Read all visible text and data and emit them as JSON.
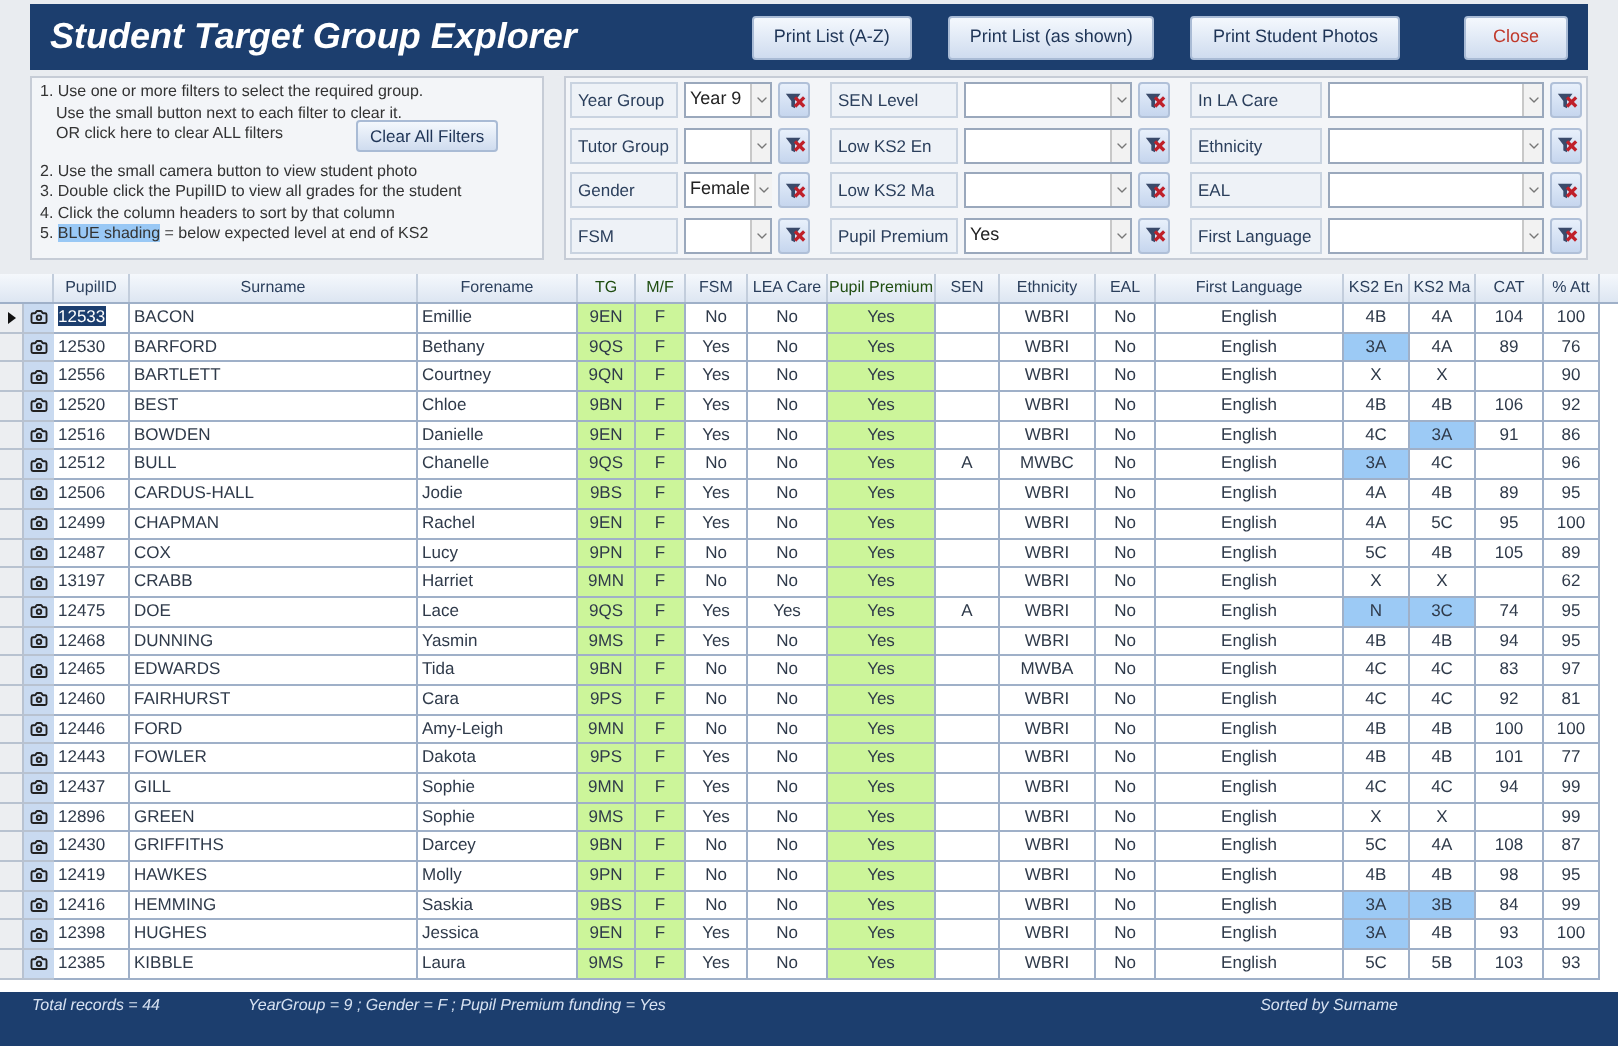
{
  "title": "Student Target Group Explorer",
  "buttons": [
    {
      "label": "Print List (A-Z)",
      "kind": "print"
    },
    {
      "label": "Print List (as shown)",
      "kind": "print"
    },
    {
      "label": "Print Student Photos",
      "kind": "print"
    },
    {
      "label": "Close",
      "kind": "close"
    }
  ],
  "instructions": [
    {
      "text": "1. Use one or more filters to select the required group."
    },
    {
      "text": "Use the small button next to each filter to clear it.",
      "indent": true
    },
    {
      "text": "OR click here to clear ALL filters",
      "indent": true
    },
    {
      "text": "2. Use the small camera button to view student photo"
    },
    {
      "text": "3. Double click the PupilID to view all grades for the student"
    },
    {
      "text": "4. Click the column headers to sort by that column"
    },
    {
      "text": "5. ",
      "highlight": "BLUE shading",
      "rest": " = below expected level at end of KS2"
    }
  ],
  "clear_all_button": "Clear All Filters",
  "filter_columns": [
    [
      {
        "label": "Year Group",
        "value": "Year 9"
      },
      {
        "label": "Tutor Group"
      },
      {
        "label": "Gender",
        "value": "Female"
      },
      {
        "label": "FSM"
      }
    ],
    [
      {
        "label": "SEN Level"
      },
      {
        "label": "Low KS2 En"
      },
      {
        "label": "Low KS2 Ma"
      },
      {
        "label": "Pupil Premium",
        "value": "Yes"
      }
    ],
    [
      {
        "label": "In LA Care"
      },
      {
        "label": "Ethnicity"
      },
      {
        "label": "EAL"
      },
      {
        "label": "First Language"
      }
    ]
  ],
  "table": {
    "columns": [
      {
        "label": "PupilID",
        "highlighted": false
      },
      {
        "label": "Surname",
        "highlighted": false
      },
      {
        "label": "Forename",
        "highlighted": false
      },
      {
        "label": "TG",
        "highlighted": true
      },
      {
        "label": "M/F",
        "highlighted": true
      },
      {
        "label": "FSM",
        "highlighted": false
      },
      {
        "label": "LEA Care",
        "highlighted": false
      },
      {
        "label": "Pupil Premium",
        "highlighted": true
      },
      {
        "label": "SEN",
        "highlighted": false
      },
      {
        "label": "Ethnicity",
        "highlighted": false
      },
      {
        "label": "EAL",
        "highlighted": false
      },
      {
        "label": "First Language",
        "highlighted": false
      },
      {
        "label": "KS2 En",
        "highlighted": false
      },
      {
        "label": "KS2 Ma",
        "highlighted": false
      },
      {
        "label": "CAT",
        "highlighted": false
      },
      {
        "label": "% Att",
        "highlighted": false
      }
    ],
    "rows": [
      {
        "selected": true,
        "cells": [
          {
            "text": "12533"
          },
          {
            "text": "BACON"
          },
          {
            "text": "Emillie"
          },
          {
            "text": "9EN"
          },
          {
            "text": "F"
          },
          {
            "text": "No"
          },
          {
            "text": "No"
          },
          {
            "text": "Yes"
          },
          {},
          {
            "text": "WBRI"
          },
          {
            "text": "No"
          },
          {
            "text": "English"
          },
          {
            "text": "4B",
            "low": false
          },
          {
            "text": "4A",
            "low": false
          },
          {
            "text": "104"
          },
          {
            "text": "100"
          }
        ]
      },
      {
        "selected": false,
        "cells": [
          {
            "text": "12530"
          },
          {
            "text": "BARFORD"
          },
          {
            "text": "Bethany"
          },
          {
            "text": "9QS"
          },
          {
            "text": "F"
          },
          {
            "text": "Yes"
          },
          {
            "text": "No"
          },
          {
            "text": "Yes"
          },
          {},
          {
            "text": "WBRI"
          },
          {
            "text": "No"
          },
          {
            "text": "English"
          },
          {
            "text": "3A",
            "low": true
          },
          {
            "text": "4A",
            "low": false
          },
          {
            "text": "89"
          },
          {
            "text": "76"
          }
        ]
      },
      {
        "selected": false,
        "cells": [
          {
            "text": "12556"
          },
          {
            "text": "BARTLETT"
          },
          {
            "text": "Courtney"
          },
          {
            "text": "9QN"
          },
          {
            "text": "F"
          },
          {
            "text": "Yes"
          },
          {
            "text": "No"
          },
          {
            "text": "Yes"
          },
          {},
          {
            "text": "WBRI"
          },
          {
            "text": "No"
          },
          {
            "text": "English"
          },
          {
            "text": "X",
            "low": false
          },
          {
            "text": "X",
            "low": false
          },
          {},
          {
            "text": "90"
          }
        ]
      },
      {
        "selected": false,
        "cells": [
          {
            "text": "12520"
          },
          {
            "text": "BEST"
          },
          {
            "text": "Chloe"
          },
          {
            "text": "9BN"
          },
          {
            "text": "F"
          },
          {
            "text": "Yes"
          },
          {
            "text": "No"
          },
          {
            "text": "Yes"
          },
          {},
          {
            "text": "WBRI"
          },
          {
            "text": "No"
          },
          {
            "text": "English"
          },
          {
            "text": "4B",
            "low": false
          },
          {
            "text": "4B",
            "low": false
          },
          {
            "text": "106"
          },
          {
            "text": "92"
          }
        ]
      },
      {
        "selected": false,
        "cells": [
          {
            "text": "12516"
          },
          {
            "text": "BOWDEN"
          },
          {
            "text": "Danielle"
          },
          {
            "text": "9EN"
          },
          {
            "text": "F"
          },
          {
            "text": "Yes"
          },
          {
            "text": "No"
          },
          {
            "text": "Yes"
          },
          {},
          {
            "text": "WBRI"
          },
          {
            "text": "No"
          },
          {
            "text": "English"
          },
          {
            "text": "4C",
            "low": false
          },
          {
            "text": "3A",
            "low": true
          },
          {
            "text": "91"
          },
          {
            "text": "86"
          }
        ]
      },
      {
        "selected": false,
        "cells": [
          {
            "text": "12512"
          },
          {
            "text": "BULL"
          },
          {
            "text": "Chanelle"
          },
          {
            "text": "9QS"
          },
          {
            "text": "F"
          },
          {
            "text": "No"
          },
          {
            "text": "No"
          },
          {
            "text": "Yes"
          },
          {
            "text": "A"
          },
          {
            "text": "MWBC"
          },
          {
            "text": "No"
          },
          {
            "text": "English"
          },
          {
            "text": "3A",
            "low": true
          },
          {
            "text": "4C",
            "low": false
          },
          {},
          {
            "text": "96"
          }
        ]
      },
      {
        "selected": false,
        "cells": [
          {
            "text": "12506"
          },
          {
            "text": "CARDUS-HALL"
          },
          {
            "text": "Jodie"
          },
          {
            "text": "9BS"
          },
          {
            "text": "F"
          },
          {
            "text": "Yes"
          },
          {
            "text": "No"
          },
          {
            "text": "Yes"
          },
          {},
          {
            "text": "WBRI"
          },
          {
            "text": "No"
          },
          {
            "text": "English"
          },
          {
            "text": "4A",
            "low": false
          },
          {
            "text": "4B",
            "low": false
          },
          {
            "text": "89"
          },
          {
            "text": "95"
          }
        ]
      },
      {
        "selected": false,
        "cells": [
          {
            "text": "12499"
          },
          {
            "text": "CHAPMAN"
          },
          {
            "text": "Rachel"
          },
          {
            "text": "9EN"
          },
          {
            "text": "F"
          },
          {
            "text": "Yes"
          },
          {
            "text": "No"
          },
          {
            "text": "Yes"
          },
          {},
          {
            "text": "WBRI"
          },
          {
            "text": "No"
          },
          {
            "text": "English"
          },
          {
            "text": "4A",
            "low": false
          },
          {
            "text": "5C",
            "low": false
          },
          {
            "text": "95"
          },
          {
            "text": "100"
          }
        ]
      },
      {
        "selected": false,
        "cells": [
          {
            "text": "12487"
          },
          {
            "text": "COX"
          },
          {
            "text": "Lucy"
          },
          {
            "text": "9PN"
          },
          {
            "text": "F"
          },
          {
            "text": "No"
          },
          {
            "text": "No"
          },
          {
            "text": "Yes"
          },
          {},
          {
            "text": "WBRI"
          },
          {
            "text": "No"
          },
          {
            "text": "English"
          },
          {
            "text": "5C",
            "low": false
          },
          {
            "text": "4B",
            "low": false
          },
          {
            "text": "105"
          },
          {
            "text": "89"
          }
        ]
      },
      {
        "selected": false,
        "cells": [
          {
            "text": "13197"
          },
          {
            "text": "CRABB"
          },
          {
            "text": "Harriet"
          },
          {
            "text": "9MN"
          },
          {
            "text": "F"
          },
          {
            "text": "No"
          },
          {
            "text": "No"
          },
          {
            "text": "Yes"
          },
          {},
          {
            "text": "WBRI"
          },
          {
            "text": "No"
          },
          {
            "text": "English"
          },
          {
            "text": "X",
            "low": false
          },
          {
            "text": "X",
            "low": false
          },
          {},
          {
            "text": "62"
          }
        ]
      },
      {
        "selected": false,
        "cells": [
          {
            "text": "12475"
          },
          {
            "text": "DOE"
          },
          {
            "text": "Lace"
          },
          {
            "text": "9QS"
          },
          {
            "text": "F"
          },
          {
            "text": "Yes"
          },
          {
            "text": "Yes"
          },
          {
            "text": "Yes"
          },
          {
            "text": "A"
          },
          {
            "text": "WBRI"
          },
          {
            "text": "No"
          },
          {
            "text": "English"
          },
          {
            "text": "N",
            "low": true
          },
          {
            "text": "3C",
            "low": true
          },
          {
            "text": "74"
          },
          {
            "text": "95"
          }
        ]
      },
      {
        "selected": false,
        "cells": [
          {
            "text": "12468"
          },
          {
            "text": "DUNNING"
          },
          {
            "text": "Yasmin"
          },
          {
            "text": "9MS"
          },
          {
            "text": "F"
          },
          {
            "text": "Yes"
          },
          {
            "text": "No"
          },
          {
            "text": "Yes"
          },
          {},
          {
            "text": "WBRI"
          },
          {
            "text": "No"
          },
          {
            "text": "English"
          },
          {
            "text": "4B",
            "low": false
          },
          {
            "text": "4B",
            "low": false
          },
          {
            "text": "94"
          },
          {
            "text": "95"
          }
        ]
      },
      {
        "selected": false,
        "cells": [
          {
            "text": "12465"
          },
          {
            "text": "EDWARDS"
          },
          {
            "text": "Tida"
          },
          {
            "text": "9BN"
          },
          {
            "text": "F"
          },
          {
            "text": "No"
          },
          {
            "text": "No"
          },
          {
            "text": "Yes"
          },
          {},
          {
            "text": "MWBA"
          },
          {
            "text": "No"
          },
          {
            "text": "English"
          },
          {
            "text": "4C",
            "low": false
          },
          {
            "text": "4C",
            "low": false
          },
          {
            "text": "83"
          },
          {
            "text": "97"
          }
        ]
      },
      {
        "selected": false,
        "cells": [
          {
            "text": "12460"
          },
          {
            "text": "FAIRHURST"
          },
          {
            "text": "Cara"
          },
          {
            "text": "9PS"
          },
          {
            "text": "F"
          },
          {
            "text": "No"
          },
          {
            "text": "No"
          },
          {
            "text": "Yes"
          },
          {},
          {
            "text": "WBRI"
          },
          {
            "text": "No"
          },
          {
            "text": "English"
          },
          {
            "text": "4C",
            "low": false
          },
          {
            "text": "4C",
            "low": false
          },
          {
            "text": "92"
          },
          {
            "text": "81"
          }
        ]
      },
      {
        "selected": false,
        "cells": [
          {
            "text": "12446"
          },
          {
            "text": "FORD"
          },
          {
            "text": "Amy-Leigh"
          },
          {
            "text": "9MN"
          },
          {
            "text": "F"
          },
          {
            "text": "No"
          },
          {
            "text": "No"
          },
          {
            "text": "Yes"
          },
          {},
          {
            "text": "WBRI"
          },
          {
            "text": "No"
          },
          {
            "text": "English"
          },
          {
            "text": "4B",
            "low": false
          },
          {
            "text": "4B",
            "low": false
          },
          {
            "text": "100"
          },
          {
            "text": "100"
          }
        ]
      },
      {
        "selected": false,
        "cells": [
          {
            "text": "12443"
          },
          {
            "text": "FOWLER"
          },
          {
            "text": "Dakota"
          },
          {
            "text": "9PS"
          },
          {
            "text": "F"
          },
          {
            "text": "Yes"
          },
          {
            "text": "No"
          },
          {
            "text": "Yes"
          },
          {},
          {
            "text": "WBRI"
          },
          {
            "text": "No"
          },
          {
            "text": "English"
          },
          {
            "text": "4B",
            "low": false
          },
          {
            "text": "4B",
            "low": false
          },
          {
            "text": "101"
          },
          {
            "text": "77"
          }
        ]
      },
      {
        "selected": false,
        "cells": [
          {
            "text": "12437"
          },
          {
            "text": "GILL"
          },
          {
            "text": "Sophie"
          },
          {
            "text": "9MN"
          },
          {
            "text": "F"
          },
          {
            "text": "Yes"
          },
          {
            "text": "No"
          },
          {
            "text": "Yes"
          },
          {},
          {
            "text": "WBRI"
          },
          {
            "text": "No"
          },
          {
            "text": "English"
          },
          {
            "text": "4C",
            "low": false
          },
          {
            "text": "4C",
            "low": false
          },
          {
            "text": "94"
          },
          {
            "text": "99"
          }
        ]
      },
      {
        "selected": false,
        "cells": [
          {
            "text": "12896"
          },
          {
            "text": "GREEN"
          },
          {
            "text": "Sophie"
          },
          {
            "text": "9MS"
          },
          {
            "text": "F"
          },
          {
            "text": "Yes"
          },
          {
            "text": "No"
          },
          {
            "text": "Yes"
          },
          {},
          {
            "text": "WBRI"
          },
          {
            "text": "No"
          },
          {
            "text": "English"
          },
          {
            "text": "X",
            "low": false
          },
          {
            "text": "X",
            "low": false
          },
          {},
          {
            "text": "99"
          }
        ]
      },
      {
        "selected": false,
        "cells": [
          {
            "text": "12430"
          },
          {
            "text": "GRIFFITHS"
          },
          {
            "text": "Darcey"
          },
          {
            "text": "9BN"
          },
          {
            "text": "F"
          },
          {
            "text": "No"
          },
          {
            "text": "No"
          },
          {
            "text": "Yes"
          },
          {},
          {
            "text": "WBRI"
          },
          {
            "text": "No"
          },
          {
            "text": "English"
          },
          {
            "text": "5C",
            "low": false
          },
          {
            "text": "4A",
            "low": false
          },
          {
            "text": "108"
          },
          {
            "text": "87"
          }
        ]
      },
      {
        "selected": false,
        "cells": [
          {
            "text": "12419"
          },
          {
            "text": "HAWKES"
          },
          {
            "text": "Molly"
          },
          {
            "text": "9PN"
          },
          {
            "text": "F"
          },
          {
            "text": "No"
          },
          {
            "text": "No"
          },
          {
            "text": "Yes"
          },
          {},
          {
            "text": "WBRI"
          },
          {
            "text": "No"
          },
          {
            "text": "English"
          },
          {
            "text": "4B",
            "low": false
          },
          {
            "text": "4B",
            "low": false
          },
          {
            "text": "98"
          },
          {
            "text": "95"
          }
        ]
      },
      {
        "selected": false,
        "cells": [
          {
            "text": "12416"
          },
          {
            "text": "HEMMING"
          },
          {
            "text": "Saskia"
          },
          {
            "text": "9BS"
          },
          {
            "text": "F"
          },
          {
            "text": "No"
          },
          {
            "text": "No"
          },
          {
            "text": "Yes"
          },
          {},
          {
            "text": "WBRI"
          },
          {
            "text": "No"
          },
          {
            "text": "English"
          },
          {
            "text": "3A",
            "low": true
          },
          {
            "text": "3B",
            "low": true
          },
          {
            "text": "84"
          },
          {
            "text": "99"
          }
        ]
      },
      {
        "selected": false,
        "cells": [
          {
            "text": "12398"
          },
          {
            "text": "HUGHES"
          },
          {
            "text": "Jessica"
          },
          {
            "text": "9EN"
          },
          {
            "text": "F"
          },
          {
            "text": "Yes"
          },
          {
            "text": "No"
          },
          {
            "text": "Yes"
          },
          {},
          {
            "text": "WBRI"
          },
          {
            "text": "No"
          },
          {
            "text": "English"
          },
          {
            "text": "3A",
            "low": true
          },
          {
            "text": "4B",
            "low": false
          },
          {
            "text": "93"
          },
          {
            "text": "100"
          }
        ]
      },
      {
        "selected": false,
        "cells": [
          {
            "text": "12385"
          },
          {
            "text": "KIBBLE"
          },
          {
            "text": "Laura"
          },
          {
            "text": "9MS"
          },
          {
            "text": "F"
          },
          {
            "text": "Yes"
          },
          {
            "text": "No"
          },
          {
            "text": "Yes"
          },
          {},
          {
            "text": "WBRI"
          },
          {
            "text": "No"
          },
          {
            "text": "English"
          },
          {
            "text": "5C",
            "low": false
          },
          {
            "text": "5B",
            "low": false
          },
          {
            "text": "103"
          },
          {
            "text": "93"
          }
        ]
      }
    ]
  },
  "status_bar": {
    "total": "Total records = 44",
    "filter": "YearGroup = 9 ; Gender = F ; Pupil Premium funding = Yes",
    "sort": "Sorted by Surname"
  }
}
